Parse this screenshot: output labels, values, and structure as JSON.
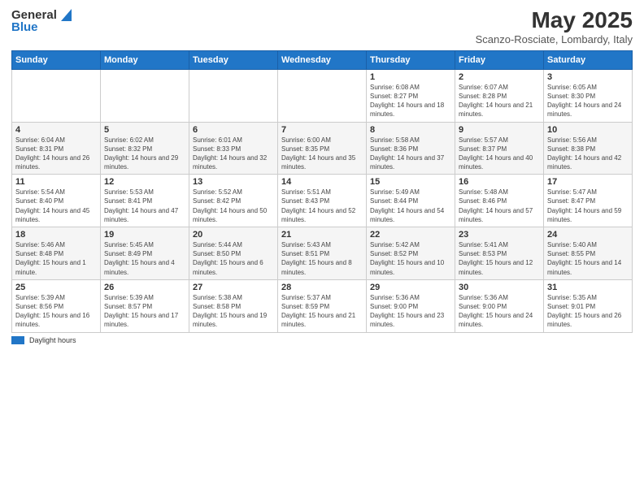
{
  "header": {
    "logo_general": "General",
    "logo_blue": "Blue",
    "title": "May 2025",
    "subtitle": "Scanzo-Rosciate, Lombardy, Italy"
  },
  "days_of_week": [
    "Sunday",
    "Monday",
    "Tuesday",
    "Wednesday",
    "Thursday",
    "Friday",
    "Saturday"
  ],
  "weeks": [
    [
      {
        "num": "",
        "info": ""
      },
      {
        "num": "",
        "info": ""
      },
      {
        "num": "",
        "info": ""
      },
      {
        "num": "",
        "info": ""
      },
      {
        "num": "1",
        "info": "Sunrise: 6:08 AM\nSunset: 8:27 PM\nDaylight: 14 hours and 18 minutes."
      },
      {
        "num": "2",
        "info": "Sunrise: 6:07 AM\nSunset: 8:28 PM\nDaylight: 14 hours and 21 minutes."
      },
      {
        "num": "3",
        "info": "Sunrise: 6:05 AM\nSunset: 8:30 PM\nDaylight: 14 hours and 24 minutes."
      }
    ],
    [
      {
        "num": "4",
        "info": "Sunrise: 6:04 AM\nSunset: 8:31 PM\nDaylight: 14 hours and 26 minutes."
      },
      {
        "num": "5",
        "info": "Sunrise: 6:02 AM\nSunset: 8:32 PM\nDaylight: 14 hours and 29 minutes."
      },
      {
        "num": "6",
        "info": "Sunrise: 6:01 AM\nSunset: 8:33 PM\nDaylight: 14 hours and 32 minutes."
      },
      {
        "num": "7",
        "info": "Sunrise: 6:00 AM\nSunset: 8:35 PM\nDaylight: 14 hours and 35 minutes."
      },
      {
        "num": "8",
        "info": "Sunrise: 5:58 AM\nSunset: 8:36 PM\nDaylight: 14 hours and 37 minutes."
      },
      {
        "num": "9",
        "info": "Sunrise: 5:57 AM\nSunset: 8:37 PM\nDaylight: 14 hours and 40 minutes."
      },
      {
        "num": "10",
        "info": "Sunrise: 5:56 AM\nSunset: 8:38 PM\nDaylight: 14 hours and 42 minutes."
      }
    ],
    [
      {
        "num": "11",
        "info": "Sunrise: 5:54 AM\nSunset: 8:40 PM\nDaylight: 14 hours and 45 minutes."
      },
      {
        "num": "12",
        "info": "Sunrise: 5:53 AM\nSunset: 8:41 PM\nDaylight: 14 hours and 47 minutes."
      },
      {
        "num": "13",
        "info": "Sunrise: 5:52 AM\nSunset: 8:42 PM\nDaylight: 14 hours and 50 minutes."
      },
      {
        "num": "14",
        "info": "Sunrise: 5:51 AM\nSunset: 8:43 PM\nDaylight: 14 hours and 52 minutes."
      },
      {
        "num": "15",
        "info": "Sunrise: 5:49 AM\nSunset: 8:44 PM\nDaylight: 14 hours and 54 minutes."
      },
      {
        "num": "16",
        "info": "Sunrise: 5:48 AM\nSunset: 8:46 PM\nDaylight: 14 hours and 57 minutes."
      },
      {
        "num": "17",
        "info": "Sunrise: 5:47 AM\nSunset: 8:47 PM\nDaylight: 14 hours and 59 minutes."
      }
    ],
    [
      {
        "num": "18",
        "info": "Sunrise: 5:46 AM\nSunset: 8:48 PM\nDaylight: 15 hours and 1 minute."
      },
      {
        "num": "19",
        "info": "Sunrise: 5:45 AM\nSunset: 8:49 PM\nDaylight: 15 hours and 4 minutes."
      },
      {
        "num": "20",
        "info": "Sunrise: 5:44 AM\nSunset: 8:50 PM\nDaylight: 15 hours and 6 minutes."
      },
      {
        "num": "21",
        "info": "Sunrise: 5:43 AM\nSunset: 8:51 PM\nDaylight: 15 hours and 8 minutes."
      },
      {
        "num": "22",
        "info": "Sunrise: 5:42 AM\nSunset: 8:52 PM\nDaylight: 15 hours and 10 minutes."
      },
      {
        "num": "23",
        "info": "Sunrise: 5:41 AM\nSunset: 8:53 PM\nDaylight: 15 hours and 12 minutes."
      },
      {
        "num": "24",
        "info": "Sunrise: 5:40 AM\nSunset: 8:55 PM\nDaylight: 15 hours and 14 minutes."
      }
    ],
    [
      {
        "num": "25",
        "info": "Sunrise: 5:39 AM\nSunset: 8:56 PM\nDaylight: 15 hours and 16 minutes."
      },
      {
        "num": "26",
        "info": "Sunrise: 5:39 AM\nSunset: 8:57 PM\nDaylight: 15 hours and 17 minutes."
      },
      {
        "num": "27",
        "info": "Sunrise: 5:38 AM\nSunset: 8:58 PM\nDaylight: 15 hours and 19 minutes."
      },
      {
        "num": "28",
        "info": "Sunrise: 5:37 AM\nSunset: 8:59 PM\nDaylight: 15 hours and 21 minutes."
      },
      {
        "num": "29",
        "info": "Sunrise: 5:36 AM\nSunset: 9:00 PM\nDaylight: 15 hours and 23 minutes."
      },
      {
        "num": "30",
        "info": "Sunrise: 5:36 AM\nSunset: 9:00 PM\nDaylight: 15 hours and 24 minutes."
      },
      {
        "num": "31",
        "info": "Sunrise: 5:35 AM\nSunset: 9:01 PM\nDaylight: 15 hours and 26 minutes."
      }
    ]
  ],
  "footer": {
    "label": "Daylight hours"
  }
}
